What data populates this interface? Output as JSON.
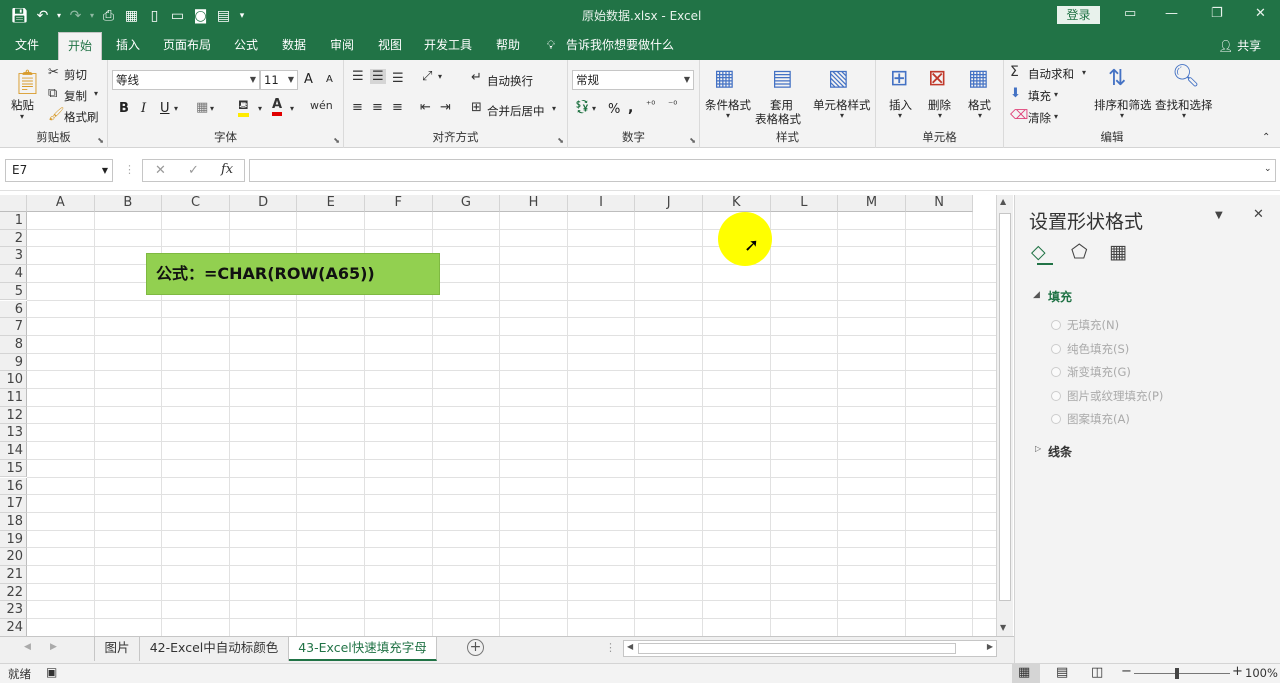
{
  "window": {
    "title": "原始数据.xlsx - Excel",
    "login_label": "登录",
    "share_label": "共享"
  },
  "tabs": [
    "文件",
    "开始",
    "插入",
    "页面布局",
    "公式",
    "数据",
    "审阅",
    "视图",
    "开发工具",
    "帮助"
  ],
  "tell_me": "告诉我你想要做什么",
  "ribbon": {
    "clipboard": {
      "paste": "粘贴",
      "cut": "剪切",
      "copy": "复制",
      "format_painter": "格式刷",
      "label": "剪贴板"
    },
    "font": {
      "name": "等线",
      "size": "11",
      "bold": "B",
      "italic": "I",
      "underline": "U",
      "grow": "A",
      "shrink": "A",
      "label": "字体"
    },
    "alignment": {
      "wrap": "自动换行",
      "merge": "合并后居中",
      "label": "对齐方式"
    },
    "number": {
      "format": "常规",
      "percent": "%",
      "comma": ",",
      "label": "数字"
    },
    "styles": {
      "conditional": "条件格式",
      "table": "套用",
      "table2": "表格格式",
      "cell": "单元格样式",
      "label": "样式"
    },
    "cells": {
      "insert": "插入",
      "delete": "删除",
      "format": "格式",
      "label": "单元格"
    },
    "editing": {
      "autosum": "自动求和",
      "fill": "填充",
      "clear": "清除",
      "sort": "排序和筛选",
      "find": "查找和选择",
      "label": "编辑"
    }
  },
  "formula_bar": {
    "name_box": "E7",
    "fx": "fx",
    "cancel": "✕",
    "enter": "✓",
    "value": ""
  },
  "columns": [
    "A",
    "B",
    "C",
    "D",
    "E",
    "F",
    "G",
    "H",
    "I",
    "J",
    "K",
    "L",
    "M",
    "N"
  ],
  "rows": [
    "1",
    "2",
    "3",
    "4",
    "5",
    "6",
    "7",
    "8",
    "9",
    "10",
    "11",
    "12",
    "13",
    "14",
    "15",
    "16",
    "17",
    "18",
    "19",
    "20",
    "21",
    "22",
    "23",
    "24"
  ],
  "note_text": "公式：=CHAR(ROW(A65))",
  "format_panel": {
    "title": "设置形状格式",
    "fill_header": "填充",
    "options": [
      "无填充(N)",
      "纯色填充(S)",
      "渐变填充(G)",
      "图片或纹理填充(P)",
      "图案填充(A)"
    ],
    "line_header": "线条"
  },
  "sheets": [
    "图片",
    "42-Excel中自动标颜色",
    "43-Excel快速填充字母"
  ],
  "status": {
    "ready": "就绪",
    "zoom": "100%"
  }
}
